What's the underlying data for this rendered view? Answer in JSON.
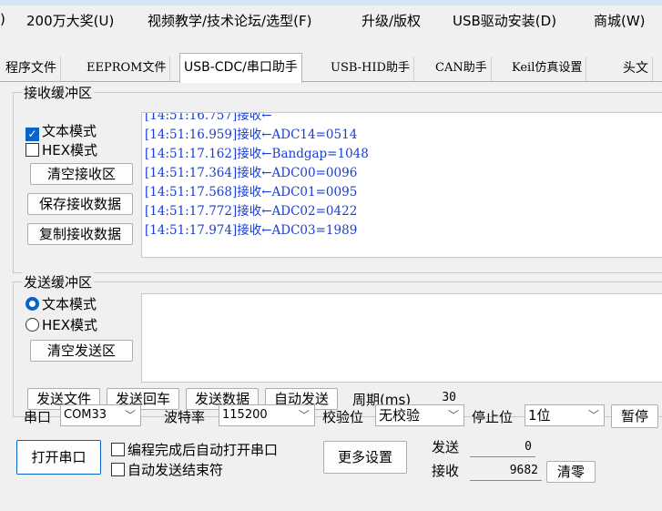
{
  "menu": {
    "items": [
      ")",
      "200万大奖(U)",
      "视频教学/技术论坛/选型(F)",
      "升级/版权",
      "USB驱动安装(D)",
      "商城(W)"
    ]
  },
  "tabs": [
    "程序文件",
    "EEPROM文件",
    "USB-CDC/串口助手",
    "USB-HID助手",
    "CAN助手",
    "Keil仿真设置",
    "头文"
  ],
  "receive": {
    "title": "接收缓冲区",
    "text_mode_label": "文本模式",
    "hex_mode_label": "HEX模式",
    "clear_button": "清空接收区",
    "save_button": "保存接收数据",
    "copy_button": "复制接收数据",
    "log": [
      "[14:51:16.959]接收←ADC14=0514",
      "[14:51:17.162]接收←Bandgap=1048",
      "[14:51:17.364]接收←ADC00=0096",
      "[14:51:17.568]接收←ADC01=0095",
      "[14:51:17.772]接收←ADC02=0422",
      "[14:51:17.974]接收←ADC03=1989"
    ],
    "partial_top_line": "接收"
  },
  "send": {
    "title": "发送缓冲区",
    "text_mode_label": "文本模式",
    "hex_mode_label": "HEX模式",
    "clear_button": "清空发送区",
    "send_file_button": "发送文件",
    "send_enter_button": "发送回车",
    "send_data_button": "发送数据",
    "auto_send_button": "自动发送",
    "period_label": "周期(ms)",
    "period_value": "30"
  },
  "port": {
    "port_label": "串口",
    "port_value": "COM33",
    "baud_label": "波特率",
    "baud_value": "115200",
    "parity_label": "校验位",
    "parity_value": "无校验",
    "stop_label": "停止位",
    "stop_value": "1位",
    "pause_button": "暂停",
    "open_button": "打开串口",
    "auto_open_label": "编程完成后自动打开串口",
    "auto_send_end_label": "自动发送结束符",
    "more_button": "更多设置",
    "sent_label": "发送",
    "sent_value": "0",
    "recv_label": "接收",
    "recv_value": "9682",
    "clear_count_button": "清零"
  }
}
